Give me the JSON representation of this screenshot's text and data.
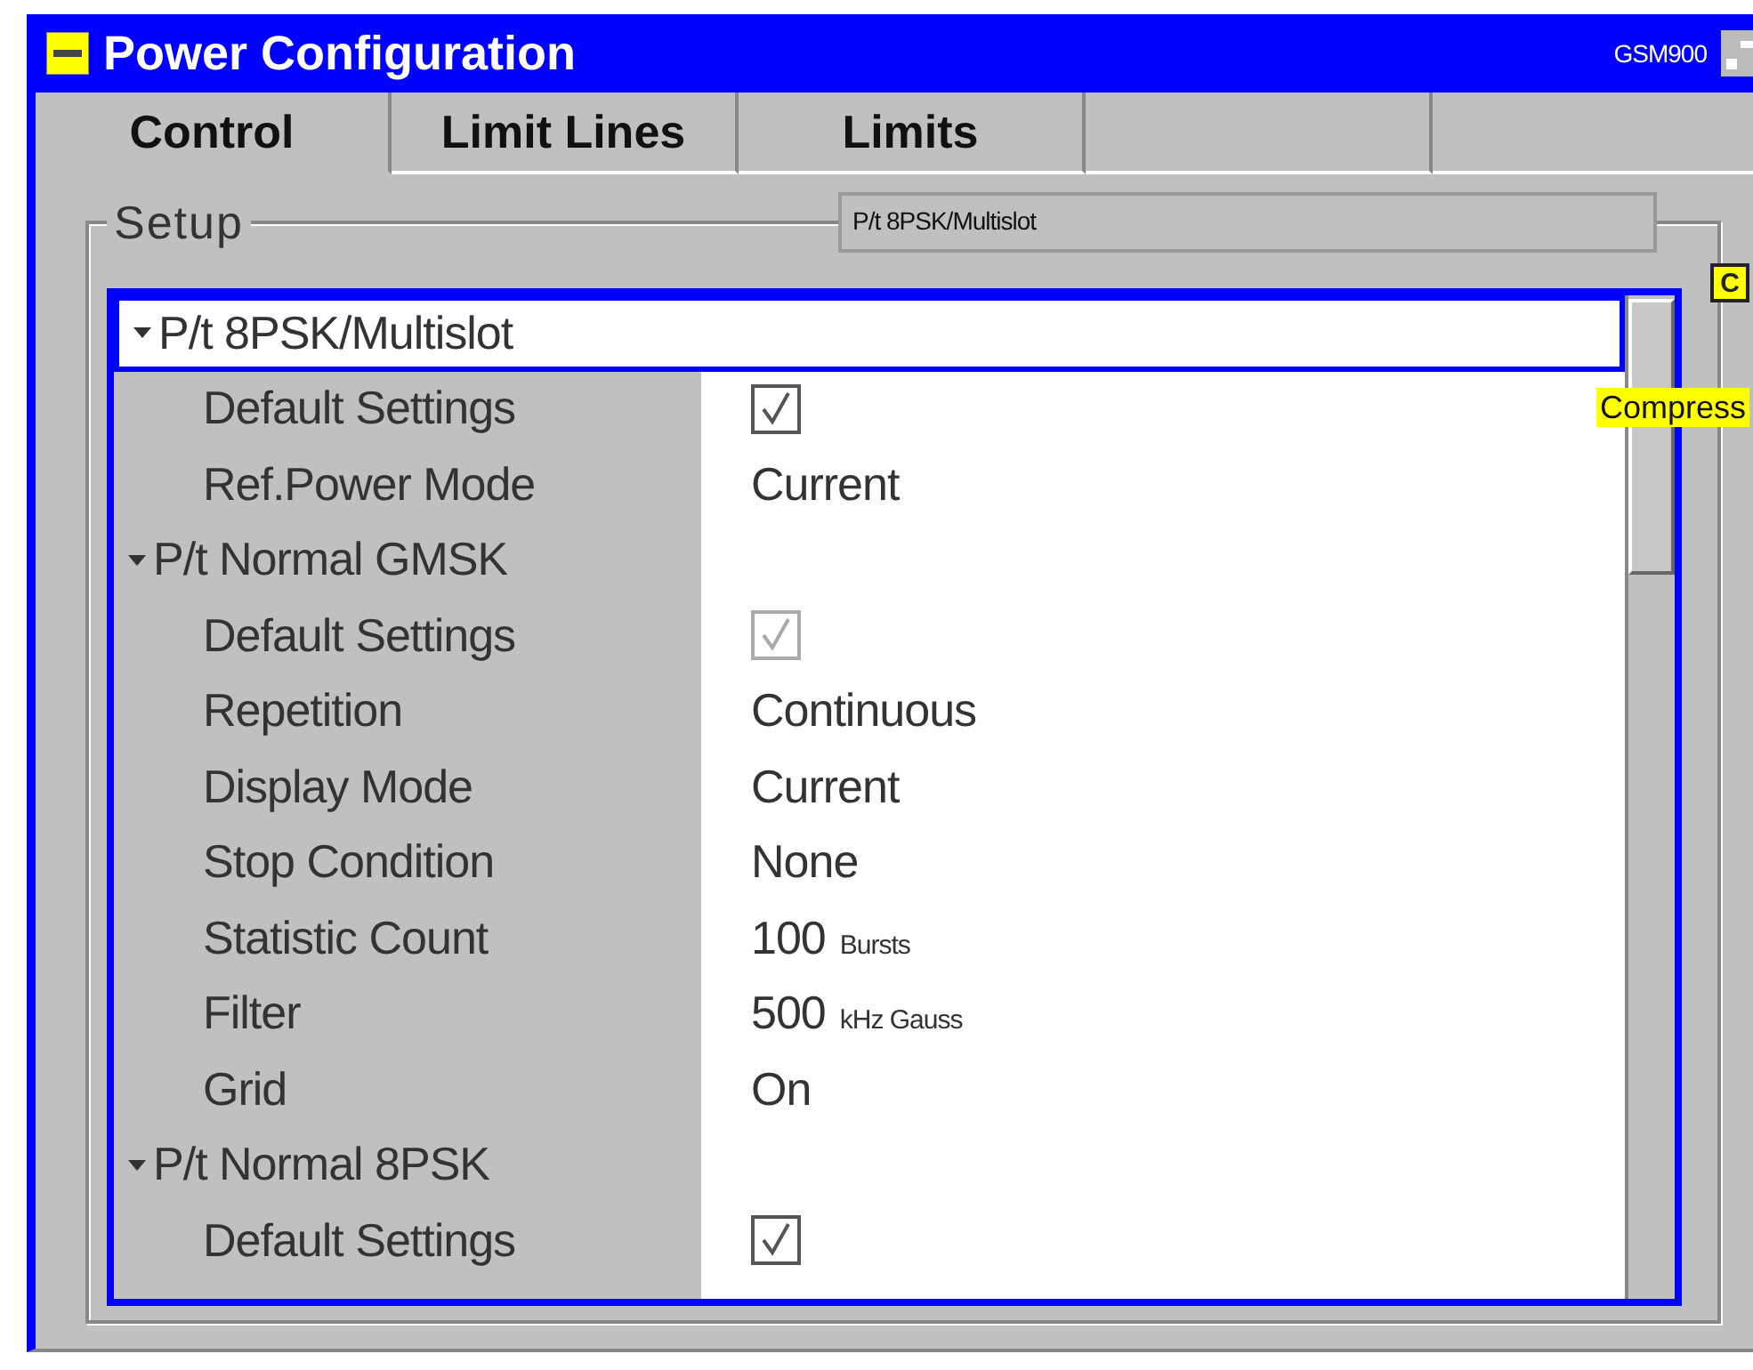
{
  "window": {
    "title": "Power Configuration",
    "band": "GSM900"
  },
  "tabs": [
    {
      "label": "Control",
      "selected": true
    },
    {
      "label": "Limit Lines",
      "selected": false
    },
    {
      "label": "Limits",
      "selected": false
    }
  ],
  "setup": {
    "legend": "Setup",
    "combo": "P/t 8PSK/Multislot",
    "side_button": "C",
    "tooltip": "Compress"
  },
  "groups": [
    {
      "title": "P/t 8PSK/Multislot",
      "expanded": true,
      "selected": true,
      "children": [
        {
          "kind": "checkbox",
          "label": "Default Settings",
          "checked": true,
          "disabled": false
        },
        {
          "kind": "value",
          "label": "Ref.Power Mode",
          "value": "Current"
        }
      ]
    },
    {
      "title": "P/t Normal GMSK",
      "expanded": true,
      "selected": false,
      "children": [
        {
          "kind": "checkbox",
          "label": "Default Settings",
          "checked": true,
          "disabled": true
        },
        {
          "kind": "value",
          "label": "Repetition",
          "value": "Continuous"
        },
        {
          "kind": "value",
          "label": "Display Mode",
          "value": "Current"
        },
        {
          "kind": "value",
          "label": "Stop Condition",
          "value": "None"
        },
        {
          "kind": "value",
          "label": "Statistic Count",
          "value": "100",
          "unit": "Bursts"
        },
        {
          "kind": "value",
          "label": "Filter",
          "value": "500",
          "unit": "kHz Gauss"
        },
        {
          "kind": "value",
          "label": "Grid",
          "value": "On"
        }
      ]
    },
    {
      "title": "P/t Normal 8PSK",
      "expanded": true,
      "selected": false,
      "children": [
        {
          "kind": "checkbox",
          "label": "Default Settings",
          "checked": true,
          "disabled": false
        }
      ]
    }
  ]
}
